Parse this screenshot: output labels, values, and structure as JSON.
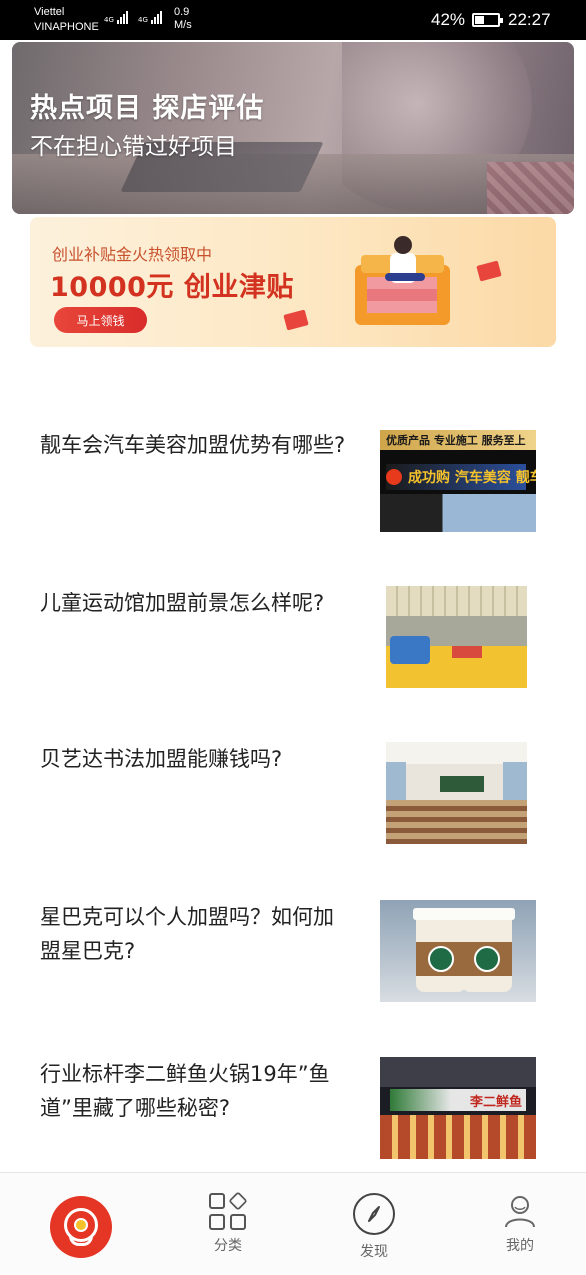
{
  "status_bar": {
    "carrier1": "Viettel",
    "carrier2": "VINAPHONE",
    "net1": "4G",
    "net2": "4G",
    "speed_value": "0.9",
    "speed_unit": "M/s",
    "battery_percent": "42%",
    "battery_level": 0.42,
    "time": "22:27"
  },
  "hero": {
    "title": "热点项目 探店评估",
    "subtitle": "不在担心错过好项目"
  },
  "promo": {
    "subtitle": "创业补贴金火热领取中",
    "headline": "10000元 创业津贴",
    "button_label": "马上领钱",
    "accent_color": "#d2321f"
  },
  "articles": [
    {
      "title": "靓车会汽车美容加盟优势有哪些?",
      "thumb_text_top": "优质产品 专业施工 服务至上",
      "thumb_text_sign": "成功购 汽车美容 靓车会"
    },
    {
      "title": "儿童运动馆加盟前景怎么样呢?"
    },
    {
      "title": "贝艺达书法加盟能赚钱吗?"
    },
    {
      "title": "星巴克可以个人加盟吗？如何加盟星巴克?"
    },
    {
      "title": "行业标杆李二鲜鱼火锅19年”鱼道”里藏了哪些秘密?",
      "thumb_text_sign": "李二鲜鱼"
    }
  ],
  "tabbar": {
    "home_color": "#e53525",
    "tabs": [
      {
        "label": "分类",
        "icon": "category-grid-icon"
      },
      {
        "label": "发现",
        "icon": "compass-icon"
      },
      {
        "label": "我的",
        "icon": "user-icon"
      }
    ]
  }
}
